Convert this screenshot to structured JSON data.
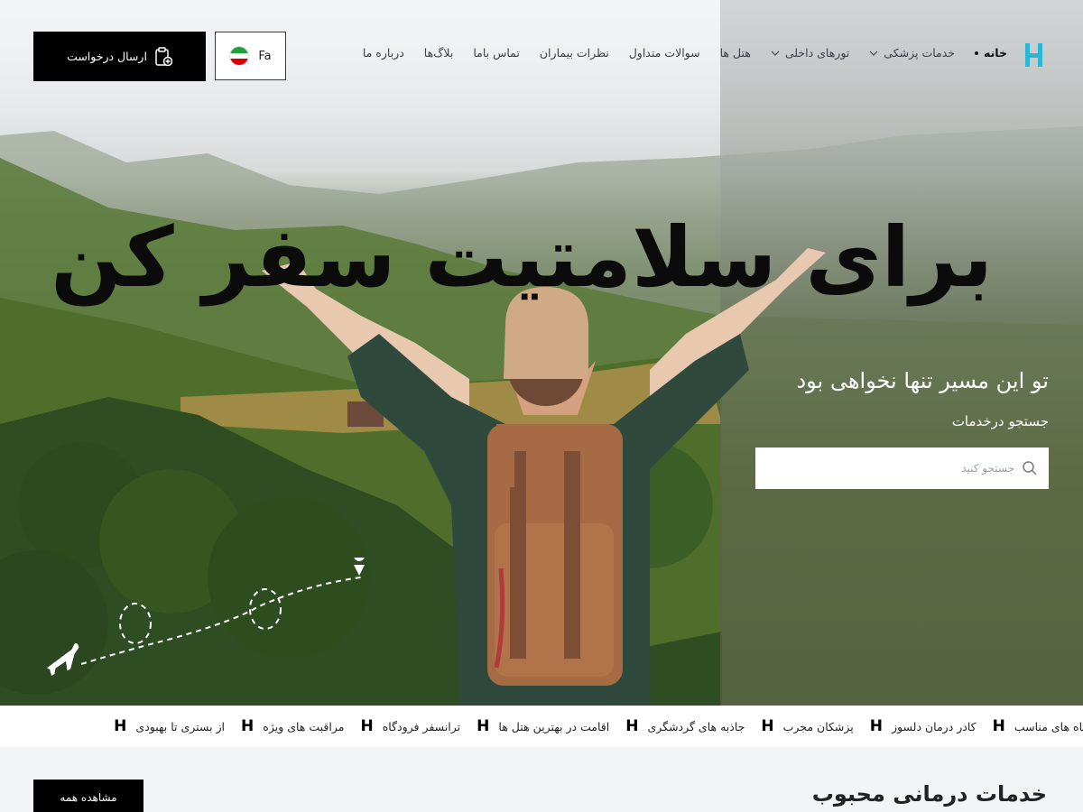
{
  "header": {
    "nav": [
      {
        "label": "خانه",
        "active": true,
        "dropdown": false
      },
      {
        "label": "خدمات پزشکی",
        "active": false,
        "dropdown": true
      },
      {
        "label": "تورهای داخلی",
        "active": false,
        "dropdown": true
      },
      {
        "label": "هتل ها",
        "active": false,
        "dropdown": false
      },
      {
        "label": "سوالات متداول",
        "active": false,
        "dropdown": false
      },
      {
        "label": "نظرات بیماران",
        "active": false,
        "dropdown": false
      },
      {
        "label": "تماس باما",
        "active": false,
        "dropdown": false
      },
      {
        "label": "بلاگ‌ها",
        "active": false,
        "dropdown": false
      },
      {
        "label": "درباره ما",
        "active": false,
        "dropdown": false
      }
    ],
    "language": "Fa",
    "request_button": "ارسال درخواست"
  },
  "hero": {
    "title": "برای سلامتیت سفر کن",
    "subtitle": "تو این مسیر تنها نخواهی بود",
    "search_label": "جستجو درخدمات",
    "search_placeholder": "جستجو کنید"
  },
  "ticker": {
    "mark": "H",
    "items": [
      "اقامتگاه های مناسب",
      "کادر درمان دلسوز",
      "پزشکان مجرب",
      "جاذبه های گردشگری",
      "اقامت در بهترین هتل ها",
      "ترانسفر فرودگاه",
      "مراقبت های ویژه",
      "از بستری تا بهبودی"
    ]
  },
  "section": {
    "title": "خدمات درمانی محبوب",
    "view_all": "مشاهده همه"
  },
  "colors": {
    "brand_logo": "#2bb6d8",
    "button_bg": "#000000",
    "flag_green": "#239f40",
    "flag_white": "#ffffff",
    "flag_red": "#da0000"
  }
}
